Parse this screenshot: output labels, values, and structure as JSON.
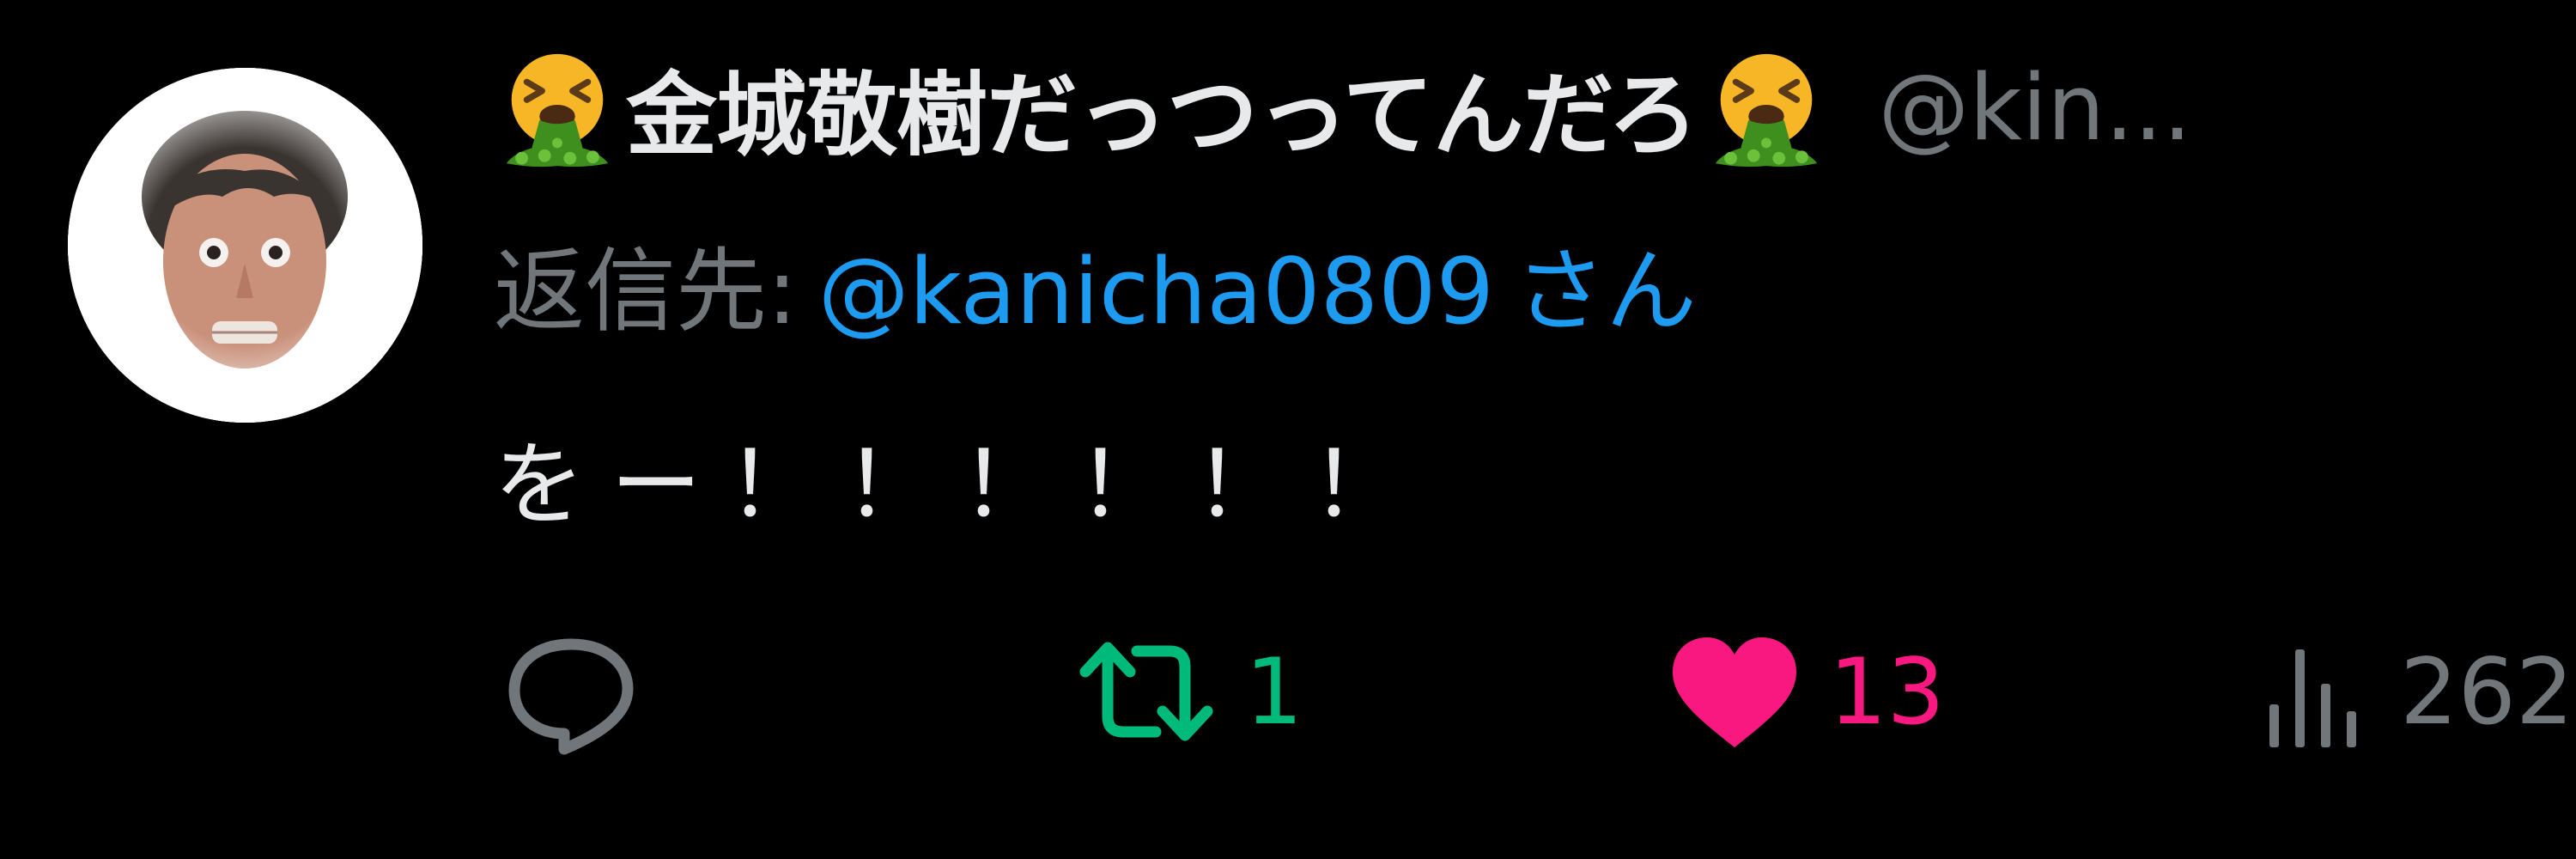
{
  "author": {
    "display_name": "金城敬樹だっつってんだろ",
    "handle": "@kin...",
    "name_emoji": "face-vomiting-icon"
  },
  "reply": {
    "prefix": "返信先:",
    "user": "@kanicha0809",
    "suffix": "さん"
  },
  "tweet_text": "をー！！！！！！",
  "actions": {
    "reply_count": "",
    "retweet_count": "1",
    "like_count": "13",
    "views_count": "262"
  },
  "colors": {
    "background": "#000000",
    "primary_text": "#e7e9ea",
    "secondary_text": "#71767b",
    "link": "#1d9bf0",
    "retweet": "#00ba7c",
    "like": "#f91880"
  }
}
